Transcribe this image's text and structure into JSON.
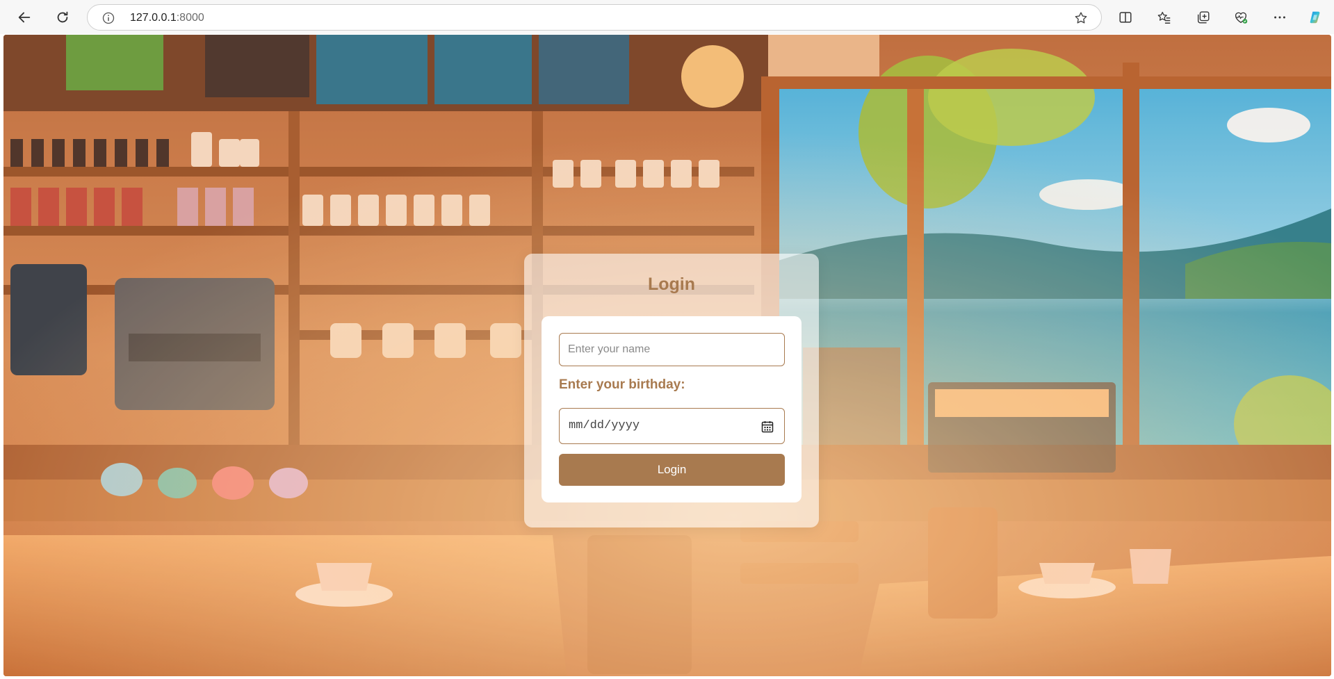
{
  "browser": {
    "url_host": "127.0.0.1",
    "url_port": ":8000",
    "icons": {
      "back": "back-arrow-icon",
      "refresh": "refresh-icon",
      "info": "site-info-icon",
      "favorite": "star-icon",
      "split_screen": "split-screen-icon",
      "favorites": "favorites-icon",
      "collections": "collections-icon",
      "browser_essentials": "heart-health-icon",
      "more": "more-icon",
      "copilot": "copilot-icon"
    }
  },
  "login": {
    "title": "Login",
    "name_placeholder": "Enter your name",
    "birthday_label": "Enter your birthday:",
    "date_placeholder": "mm/dd/yyyy",
    "button_label": "Login"
  },
  "colors": {
    "accent": "#a87a4f",
    "card_background": "rgba(255,255,255,0.58)",
    "button_text": "#ffffff"
  }
}
